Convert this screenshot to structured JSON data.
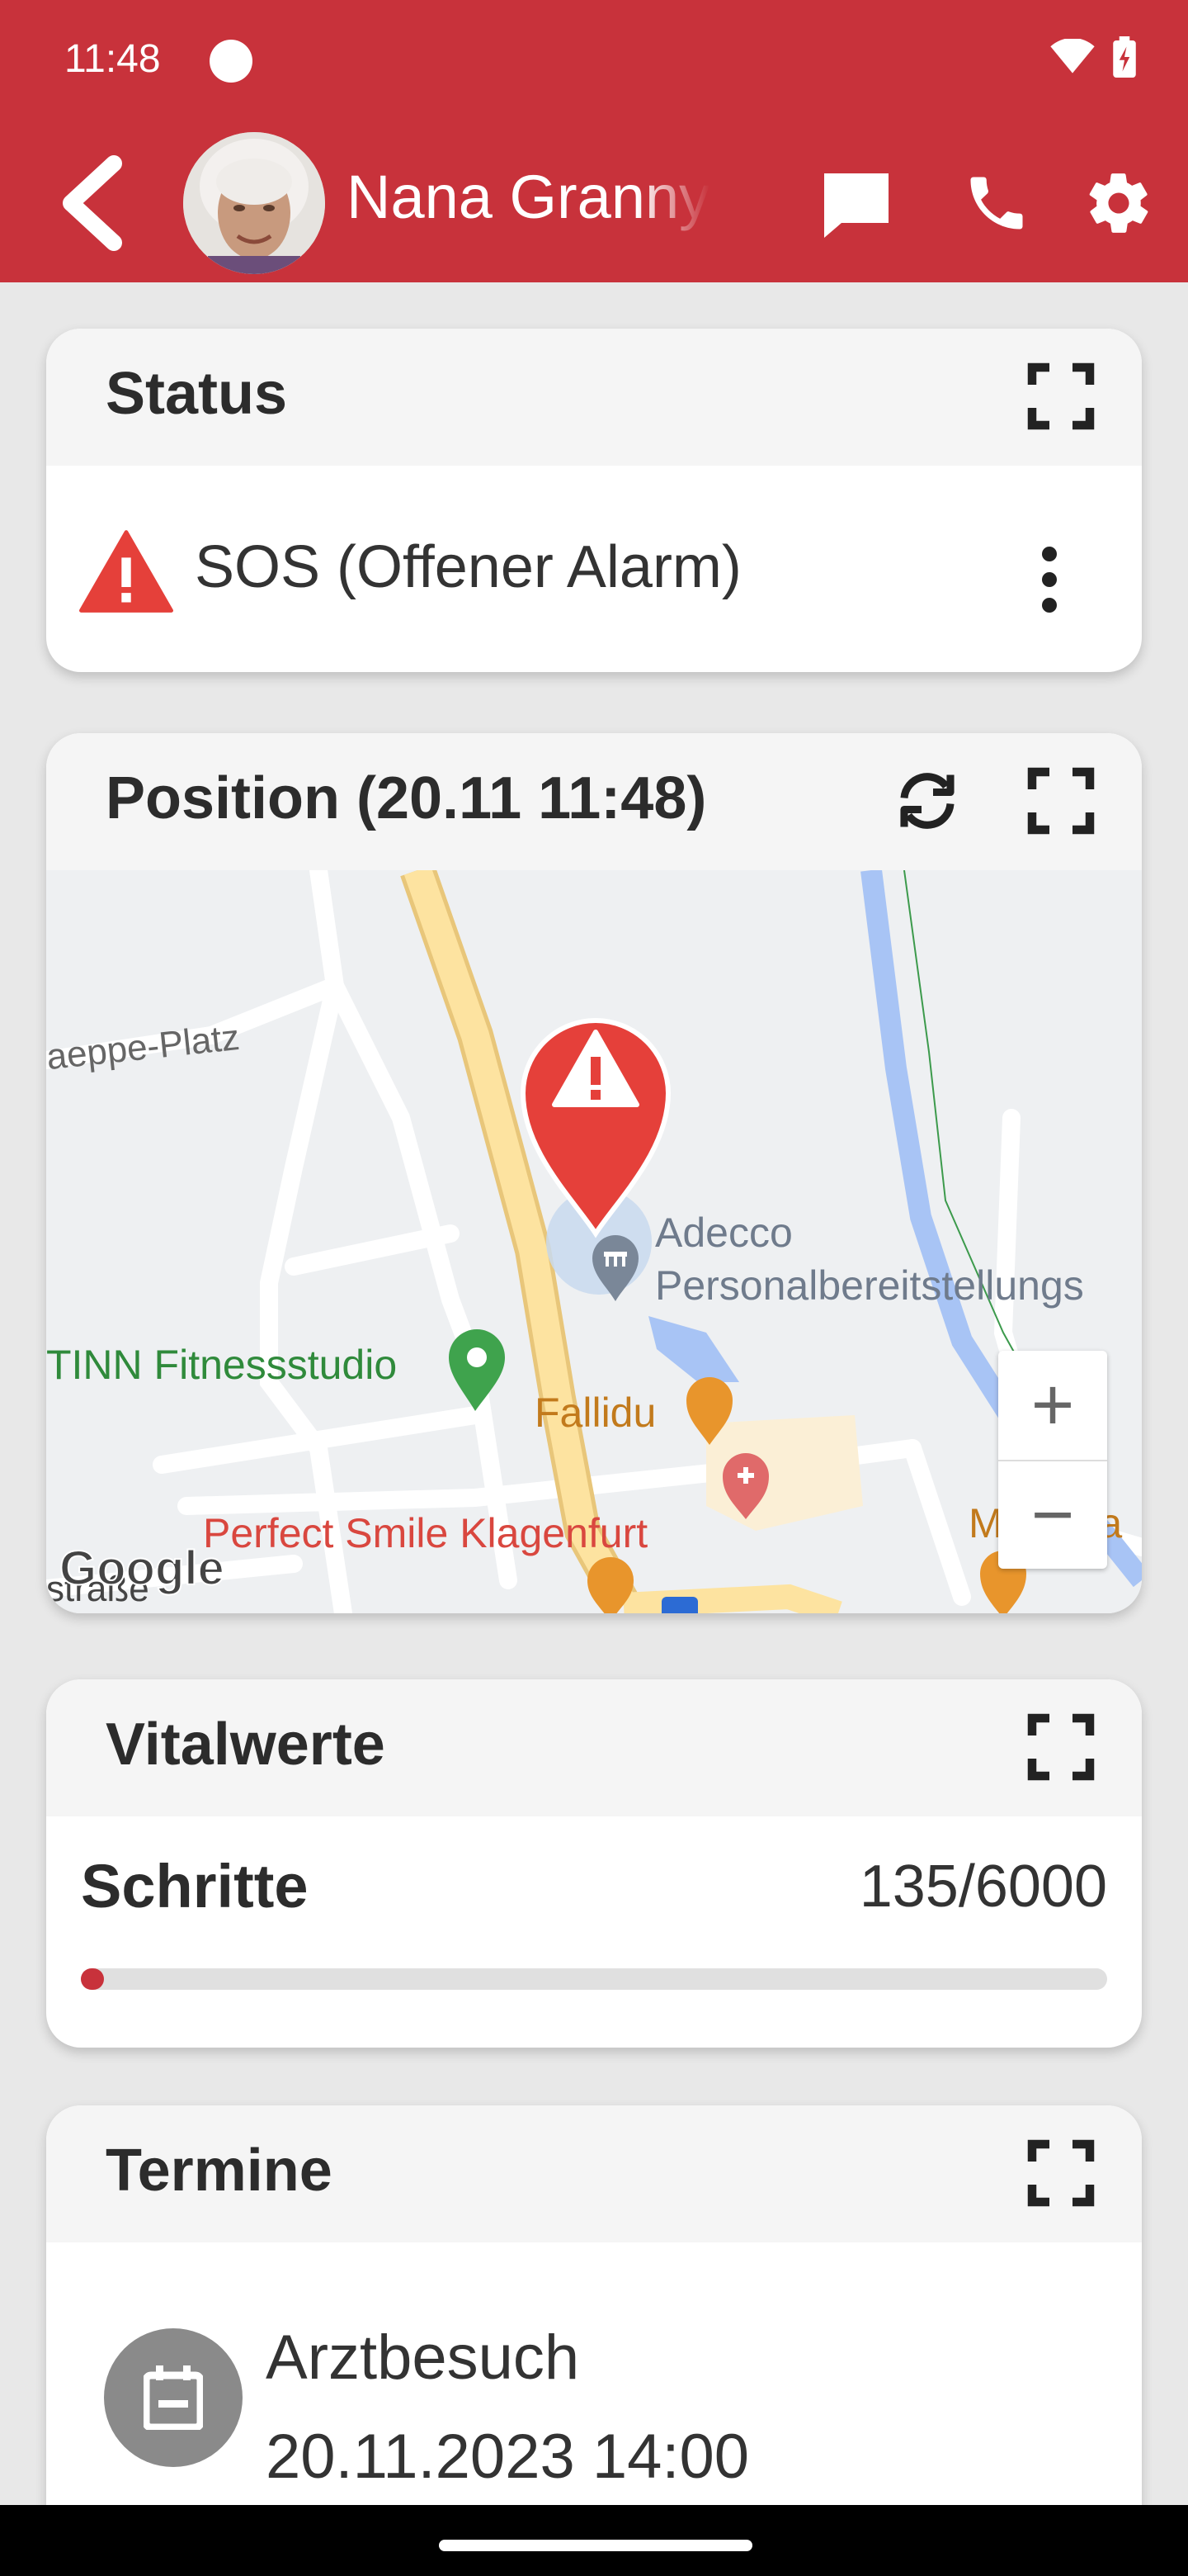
{
  "status_bar": {
    "time": "11:48"
  },
  "app_bar": {
    "title": "Nana Granny",
    "accent": "#c8323b"
  },
  "status_card": {
    "title": "Status",
    "status_text": "SOS (Offener Alarm)",
    "icons": [
      "warning-icon",
      "more-vert-icon",
      "expand-icon"
    ]
  },
  "position_card": {
    "title": "Position (20.11 11:48)",
    "map_labels": {
      "platz": "aeppe-Platz",
      "adecco_1": "Adecco",
      "adecco_2": "Personalbereitstellungs",
      "tinn": "TINN Fitnessstudio",
      "fallidu": "Fallidu",
      "smile": "Perfect Smile Klagenfurt",
      "mcdona": "McDona",
      "strasse": "straße",
      "google": "Google"
    },
    "zoom_in": "+",
    "zoom_out": "−"
  },
  "vitals_card": {
    "title": "Vitalwerte",
    "steps_label": "Schritte",
    "steps_value": "135/6000",
    "steps_progress": 0.0225
  },
  "appointments_card": {
    "title": "Termine",
    "item_title": "Arztbesuch",
    "item_date": "20.11.2023 14:00"
  }
}
